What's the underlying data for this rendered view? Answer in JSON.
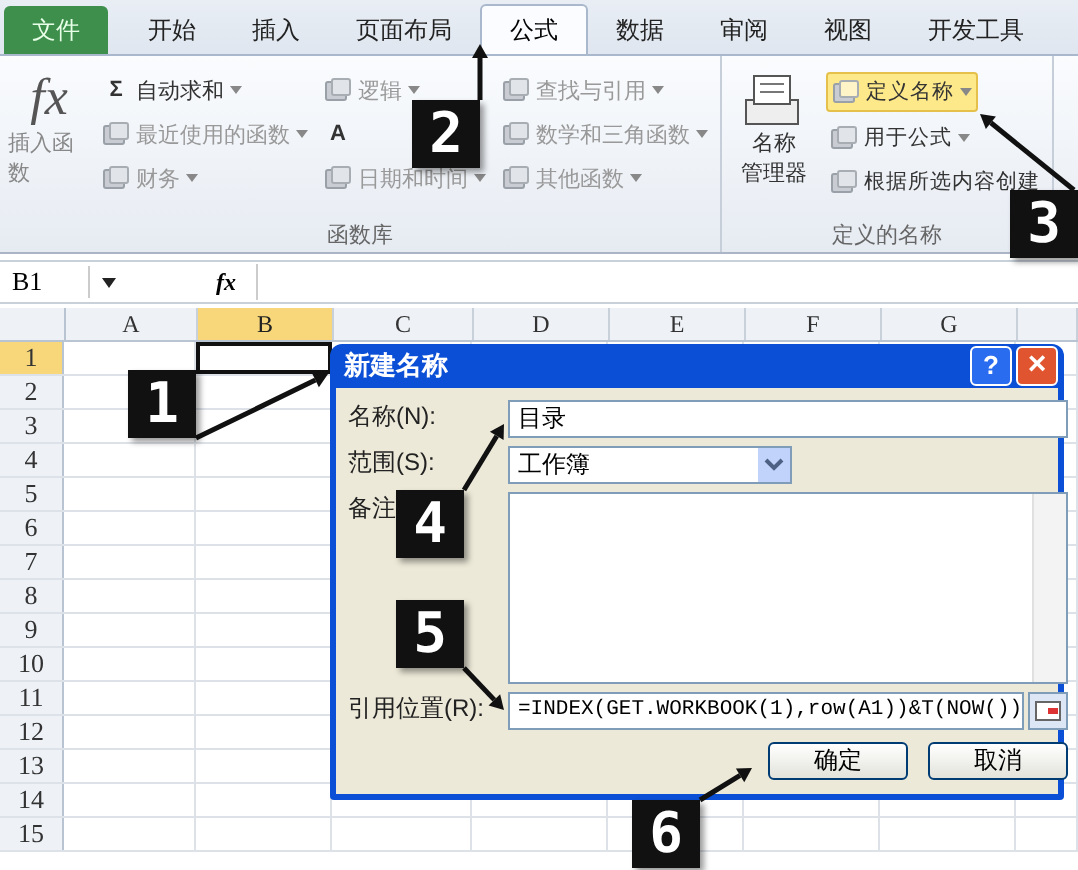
{
  "tabs": [
    {
      "label": "文件",
      "kind": "file",
      "selected": false
    },
    {
      "label": "开始",
      "kind": "tab",
      "selected": false
    },
    {
      "label": "插入",
      "kind": "tab",
      "selected": false
    },
    {
      "label": "页面布局",
      "kind": "tab",
      "selected": false
    },
    {
      "label": "公式",
      "kind": "tab",
      "selected": true
    },
    {
      "label": "数据",
      "kind": "tab",
      "selected": false
    },
    {
      "label": "审阅",
      "kind": "tab",
      "selected": false
    },
    {
      "label": "视图",
      "kind": "tab",
      "selected": false
    },
    {
      "label": "开发工具",
      "kind": "tab",
      "selected": false
    }
  ],
  "ribbon": {
    "groups": [
      {
        "label": "函数库",
        "large_button": {
          "symbol": "fx",
          "label": "插入函数"
        },
        "columns": [
          [
            {
              "symbol": "Σ",
              "label": "自动求和",
              "dropdown": true,
              "highlighted": false
            },
            {
              "label": "最近使用的函数",
              "dropdown": true,
              "highlighted": false
            },
            {
              "label": "财务",
              "dropdown": true,
              "highlighted": false
            }
          ],
          [
            {
              "label": "逻辑",
              "dropdown": true,
              "highlighted": false
            },
            {
              "symbol": "A",
              "dropdown": false,
              "highlighted": false
            },
            {
              "label": "日期和时间",
              "dropdown": true,
              "highlighted": false
            }
          ],
          [
            {
              "label": "查找与引用",
              "dropdown": true,
              "highlighted": false
            },
            {
              "label": "数学和三角函数",
              "dropdown": true,
              "highlighted": false
            },
            {
              "label": "其他函数",
              "dropdown": true,
              "highlighted": false
            }
          ]
        ]
      },
      {
        "label": "定义的名称",
        "large_button": {
          "label_lines": [
            "名称",
            "管理器"
          ]
        },
        "columns": [
          [
            {
              "label": "定义名称",
              "dropdown": true,
              "highlighted": true
            },
            {
              "label": "用于公式",
              "dropdown": true,
              "highlighted": false
            },
            {
              "label": "根据所选内容创建",
              "dropdown": false,
              "highlighted": false
            }
          ]
        ]
      }
    ]
  },
  "formula_bar": {
    "name_box": "B1",
    "symbol": "fx"
  },
  "sheet": {
    "columns": [
      {
        "label": "A",
        "selected": false
      },
      {
        "label": "B",
        "selected": true
      },
      {
        "label": "C",
        "selected": false
      },
      {
        "label": "D",
        "selected": false
      },
      {
        "label": "E",
        "selected": false
      },
      {
        "label": "F",
        "selected": false
      },
      {
        "label": "G",
        "selected": false
      }
    ],
    "rows": [
      {
        "label": "1",
        "selected": true
      },
      {
        "label": "2",
        "selected": false
      },
      {
        "label": "3",
        "selected": false
      },
      {
        "label": "4",
        "selected": false
      },
      {
        "label": "5",
        "selected": false
      },
      {
        "label": "6",
        "selected": false
      },
      {
        "label": "7",
        "selected": false
      },
      {
        "label": "8",
        "selected": false
      },
      {
        "label": "9",
        "selected": false
      },
      {
        "label": "10",
        "selected": false
      },
      {
        "label": "11",
        "selected": false
      },
      {
        "label": "12",
        "selected": false
      },
      {
        "label": "13",
        "selected": false
      },
      {
        "label": "14",
        "selected": false
      },
      {
        "label": "15",
        "selected": false
      }
    ]
  },
  "dialog": {
    "title": "新建名称",
    "help": "?",
    "close": "×",
    "name_label": "名称(N):",
    "name_value": "目录",
    "scope_label": "范围(S):",
    "scope_value": "工作簿",
    "comment_label": "备注",
    "refers_label": "引用位置(R):",
    "refers_value": "=INDEX(GET.WORKBOOK(1),row(A1))&T(NOW())",
    "buttons": [
      "确定",
      "取消"
    ]
  },
  "callouts": [
    {
      "label": "1"
    },
    {
      "label": "2"
    },
    {
      "label": "3"
    },
    {
      "label": "4"
    },
    {
      "label": "5"
    },
    {
      "label": "6"
    }
  ]
}
